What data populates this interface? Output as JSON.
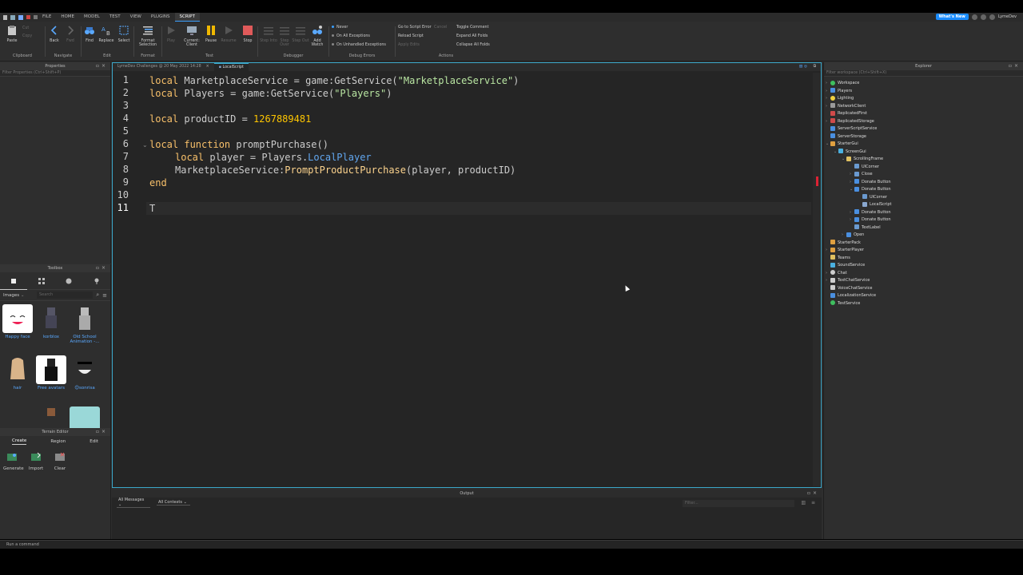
{
  "menubar": {
    "tabs": [
      "FILE",
      "HOME",
      "MODEL",
      "TEST",
      "VIEW",
      "PLUGINS",
      "SCRIPT"
    ],
    "active_tab": "SCRIPT",
    "whats_new": "What's New",
    "user": "LymeDev"
  },
  "ribbon": {
    "clipboard": {
      "label": "Clipboard",
      "paste": "Paste",
      "cut": "Cut",
      "copy": "Copy"
    },
    "navigate": {
      "label": "Navigate",
      "back": "Back",
      "fwd": "Fwd"
    },
    "edit": {
      "label": "Edit",
      "find": "Find",
      "replace": "Replace",
      "select": "Select"
    },
    "format": {
      "label": "Format",
      "format_selection": "Format Selection"
    },
    "test": {
      "label": "Test",
      "play": "Play",
      "current_client": "Current: Client",
      "pause": "Pause",
      "resume": "Resume",
      "stop": "Stop"
    },
    "debugger": {
      "label": "Debugger",
      "step_into": "Step Into",
      "step_over": "Step Over",
      "step_out": "Step Out",
      "add_watch": "Add Watch"
    },
    "debug_errors": {
      "label": "Debug Errors",
      "never": "Never",
      "on_all": "On All Exceptions",
      "on_unhandled": "On Unhandled Exceptions"
    },
    "actions": {
      "label": "Actions",
      "go_to_error": "Go to Script Error",
      "cancel": "Cancel",
      "reload": "Reload Script",
      "apply_edits": "Apply Edits",
      "toggle_comment": "Toggle Comment",
      "expand_folds": "Expand All Folds",
      "collapse_folds": "Collapse All Folds"
    }
  },
  "properties": {
    "title": "Properties",
    "filter_placeholder": "Filter Properties (Ctrl+Shift+P)"
  },
  "toolbox": {
    "title": "Toolbox",
    "category": "Images",
    "search_placeholder": "Search",
    "items": [
      {
        "name": "Happy face"
      },
      {
        "name": "korblox"
      },
      {
        "name": "Old School Animation -..."
      },
      {
        "name": "hair"
      },
      {
        "name": "Free avatars"
      },
      {
        "name": "😊sonrisa"
      }
    ]
  },
  "terrain": {
    "title": "Terrain Editor",
    "tabs": [
      "Create",
      "Region",
      "Edit"
    ],
    "tools": [
      "Generate",
      "Import",
      "Clear"
    ]
  },
  "editor": {
    "tabs": [
      {
        "label": "LymeDev Challenges @ 20 May 2022 14:28"
      },
      {
        "label": "LocalScript"
      }
    ],
    "line_numbers": [
      "1",
      "2",
      "3",
      "4",
      "5",
      "6",
      "7",
      "8",
      "9",
      "10",
      "11"
    ],
    "code": {
      "l1": {
        "kw": "local",
        "a": " MarketplaceService = game:GetService(",
        "s": "\"MarketplaceService\"",
        "b": ")"
      },
      "l2": {
        "kw": "local",
        "a": " Players = game:GetService(",
        "s": "\"Players\"",
        "b": ")"
      },
      "l4": {
        "kw": "local",
        "a": " productID = ",
        "n": "1267889481"
      },
      "l6": {
        "kw": "local function",
        "a": " promptPurchase()"
      },
      "l7": {
        "kw": "local",
        "a": " player = Players.",
        "p": "LocalPlayer"
      },
      "l8": {
        "a": "MarketplaceService:",
        "f": "PromptProductPurchase",
        "b": "(player, productID)"
      },
      "l9": {
        "kw": "end"
      },
      "l11": {
        "a": "T"
      }
    }
  },
  "output": {
    "title": "Output",
    "messages": "All Messages",
    "contexts": "All Contexts",
    "filter_placeholder": "Filter..."
  },
  "explorer": {
    "title": "Explorer",
    "filter_placeholder": "Filter workspace (Ctrl+Shift+X)",
    "nodes": [
      {
        "label": "Workspace",
        "color": "#3fbf5f"
      },
      {
        "label": "Players",
        "color": "#4a8fe0"
      },
      {
        "label": "Lighting",
        "color": "#f0d040"
      },
      {
        "label": "NetworkClient",
        "color": "#9a9a9a"
      },
      {
        "label": "ReplicatedFirst",
        "color": "#d04a4a"
      },
      {
        "label": "ReplicatedStorage",
        "color": "#d04a4a"
      },
      {
        "label": "ServerScriptService",
        "color": "#4a8fe0"
      },
      {
        "label": "ServerStorage",
        "color": "#4a8fe0"
      },
      {
        "label": "StarterGui",
        "color": "#e0a040"
      },
      {
        "label": "ScreenGui",
        "color": "#4ab0e0"
      },
      {
        "label": "ScrollingFrame",
        "color": "#e0c060"
      },
      {
        "label": "UICorner",
        "color": "#6a9ad0"
      },
      {
        "label": "Close",
        "color": "#6a9ad0"
      },
      {
        "label": "Donate Button",
        "color": "#4a8fe0"
      },
      {
        "label": "Donate Button",
        "color": "#4a8fe0"
      },
      {
        "label": "UICorner",
        "color": "#6a9ad0"
      },
      {
        "label": "LocalScript",
        "color": "#8aa8d0"
      },
      {
        "label": "Donate Button",
        "color": "#4a8fe0"
      },
      {
        "label": "Donate Button",
        "color": "#4a8fe0"
      },
      {
        "label": "TextLabel",
        "color": "#6a9ad0"
      },
      {
        "label": "Open",
        "color": "#4a8fe0"
      },
      {
        "label": "StarterPack",
        "color": "#e0a040"
      },
      {
        "label": "StarterPlayer",
        "color": "#e0a040"
      },
      {
        "label": "Teams",
        "color": "#e0c060"
      },
      {
        "label": "SoundService",
        "color": "#4ab0e0"
      },
      {
        "label": "Chat",
        "color": "#cfcfcf"
      },
      {
        "label": "TextChatService",
        "color": "#cfcfcf"
      },
      {
        "label": "VoiceChatService",
        "color": "#cfcfcf"
      },
      {
        "label": "LocalizationService",
        "color": "#4a8fe0"
      },
      {
        "label": "TestService",
        "color": "#3fbf5f"
      }
    ]
  },
  "command_bar": {
    "placeholder": "Run a command"
  }
}
